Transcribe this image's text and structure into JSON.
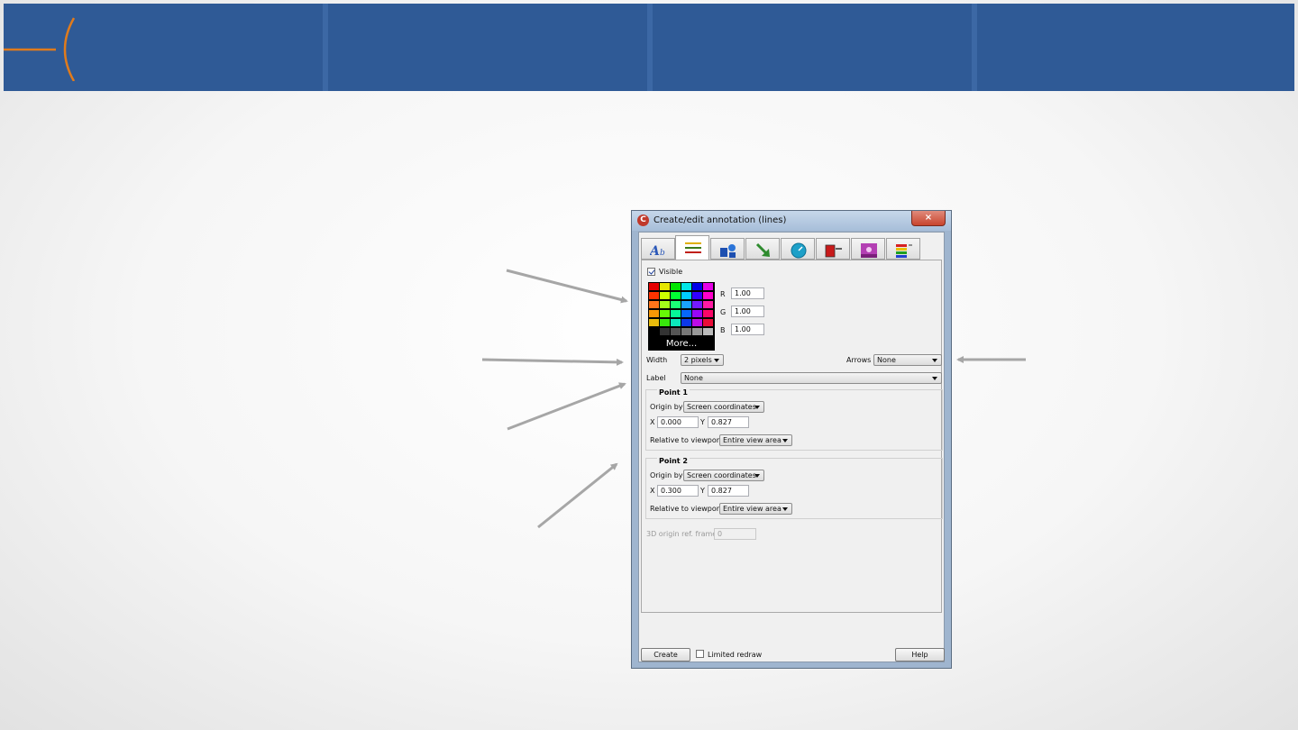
{
  "colors": {
    "banner": "#2f5a96",
    "accent_orange": "#e07b1c",
    "arrow_gray": "#a6a6a6"
  },
  "dialog": {
    "title": "Create/edit annotation (lines)",
    "close_label": "×",
    "app_icon_glyph": "C",
    "tabs": [
      {
        "icon": "text-annotation-icon",
        "active": false
      },
      {
        "icon": "line-annotation-icon",
        "active": true
      },
      {
        "icon": "shapes-annotation-icon",
        "active": false
      },
      {
        "icon": "arrow-annotation-icon",
        "active": false
      },
      {
        "icon": "clock-annotation-icon",
        "active": false
      },
      {
        "icon": "legend-annotation-icon",
        "active": false
      },
      {
        "icon": "image-annotation-icon",
        "active": false
      },
      {
        "icon": "colorbar-annotation-icon",
        "active": false
      }
    ],
    "visible_label": "Visible",
    "visible_checked": true,
    "palette_more": "More...",
    "rgb": [
      {
        "label": "R",
        "value": "1.00"
      },
      {
        "label": "G",
        "value": "1.00"
      },
      {
        "label": "B",
        "value": "1.00"
      }
    ],
    "width_label": "Width",
    "width_value": "2 pixels",
    "arrows_label": "Arrows",
    "arrows_value": "None",
    "label_label": "Label",
    "label_value": "None",
    "point1": {
      "title": "Point 1",
      "origin_label": "Origin by",
      "origin_value": "Screen coordinates",
      "x_label": "X",
      "x_value": "0.000",
      "y_label": "Y",
      "y_value": "0.827",
      "viewport_label": "Relative to viewport",
      "viewport_value": "Entire view area"
    },
    "point2": {
      "title": "Point 2",
      "origin_label": "Origin by",
      "origin_value": "Screen coordinates",
      "x_label": "X",
      "x_value": "0.300",
      "y_label": "Y",
      "y_value": "0.827",
      "viewport_label": "Relative to viewport",
      "viewport_value": "Entire view area"
    },
    "ref_frame_label": "3D origin ref. frame",
    "ref_frame_value": "0",
    "create_label": "Create",
    "limited_redraw_label": "Limited redraw",
    "help_label": "Help"
  }
}
